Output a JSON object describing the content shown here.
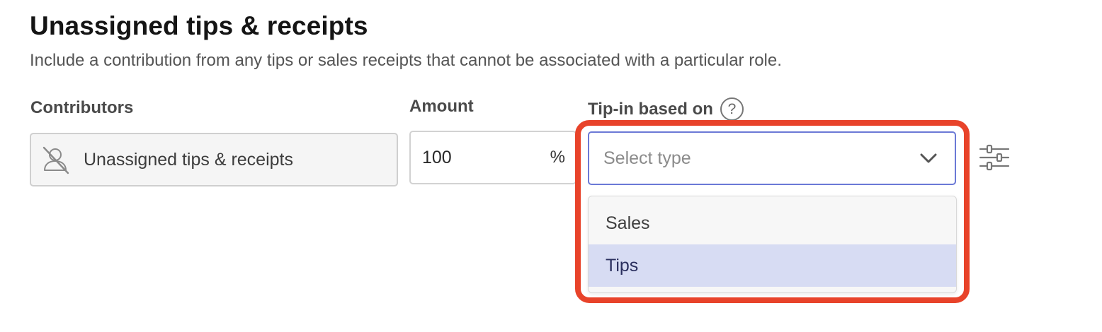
{
  "section": {
    "title": "Unassigned tips & receipts",
    "description": "Include a contribution from any tips or sales receipts that cannot be associated with a particular role."
  },
  "columns": {
    "contributors": "Contributors",
    "amount": "Amount",
    "tip_in": "Tip-in based on",
    "help_glyph": "?"
  },
  "row": {
    "contributor_name": "Unassigned tips & receipts",
    "contributor_icon": "user-slash-icon",
    "amount_value": "100",
    "amount_unit": "%",
    "tip_in_placeholder": "Select type",
    "settings_icon": "sliders-icon"
  },
  "dropdown": {
    "options": [
      {
        "label": "Sales",
        "selected": false
      },
      {
        "label": "Tips",
        "selected": true
      }
    ]
  },
  "colors": {
    "highlight": "#e8432a",
    "focus_border": "#6b79d6",
    "selected_option": "#d7dcf3"
  }
}
